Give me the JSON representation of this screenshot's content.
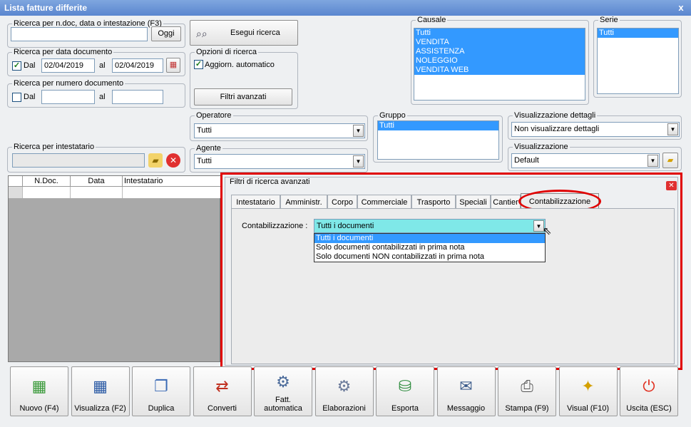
{
  "window": {
    "title": "Lista fatture differite",
    "close": "x"
  },
  "search": {
    "legend": "Ricerca per n.doc, data o intestazione (F3)",
    "value": "",
    "oggi": "Oggi",
    "eseguiRicerca": "Esegui ricerca"
  },
  "dateSearch": {
    "legend": "Ricerca per data documento",
    "dal": "Dal",
    "dal_checked": "✓",
    "from": "02/04/2019",
    "al": "al",
    "to": "02/04/2019"
  },
  "numSearch": {
    "legend": "Ricerca per numero documento",
    "dal": "Dal",
    "al": "al",
    "from": "",
    "to": ""
  },
  "options": {
    "legend": "Opzioni di ricerca",
    "aggiorn": "Aggiorn. automatico",
    "aggiorn_checked": "✓",
    "filtri": "Filtri avanzati"
  },
  "causale": {
    "legend": "Causale",
    "items": [
      "Tutti",
      "VENDITA",
      "ASSISTENZA",
      "NOLEGGIO",
      "VENDITA WEB"
    ]
  },
  "serie": {
    "legend": "Serie",
    "items": [
      "Tutti"
    ]
  },
  "operatore": {
    "legend": "Operatore",
    "value": "Tutti"
  },
  "agente": {
    "legend": "Agente",
    "value": "Tutti"
  },
  "gruppo": {
    "legend": "Gruppo",
    "items": [
      "Tutti"
    ]
  },
  "visDettagli": {
    "legend": "Visualizzazione dettagli",
    "value": "Non visualizzare dettagli"
  },
  "visualizzazione": {
    "legend": "Visualizzazione",
    "value": "Default"
  },
  "intestatario": {
    "legend": "Ricerca per intestatario",
    "value": ""
  },
  "grid": {
    "columns": [
      "N.Doc.",
      "Data",
      "Intestatario"
    ]
  },
  "advanced": {
    "legend": "Filtri di ricerca avanzati",
    "tabs": [
      "Intestatario",
      "Amministr.",
      "Corpo",
      "Commerciale",
      "Trasporto",
      "Speciali",
      "Cantier",
      "Contabilizzazione"
    ],
    "active_tab": "Contabilizzazione",
    "label": "Contabilizzazione :",
    "value": "Tutti i documenti",
    "options": [
      "Tutti i documenti",
      "Solo documenti contabilizzati in prima nota",
      "Solo documenti NON contabilizzati in prima nota"
    ]
  },
  "toolbar": [
    {
      "label": "Nuovo (F4)",
      "icon": "new-doc-icon",
      "glyph": "▦",
      "color": "#3a9a3a"
    },
    {
      "label": "Visualizza (F2)",
      "icon": "view-doc-icon",
      "glyph": "▦",
      "color": "#2a5aa5"
    },
    {
      "label": "Duplica",
      "icon": "duplicate-icon",
      "glyph": "❐",
      "color": "#3a6ab5"
    },
    {
      "label": "Converti",
      "icon": "convert-icon",
      "glyph": "⇄",
      "color": "#c03020"
    },
    {
      "label": "Fatt.\nautomatica",
      "icon": "gear-magnifier-icon",
      "glyph": "⚙",
      "color": "#4a6a9a"
    },
    {
      "label": "Elaborazioni",
      "icon": "processing-icon",
      "glyph": "⚙",
      "color": "#6a7a9a"
    },
    {
      "label": "Esporta",
      "icon": "export-icon",
      "glyph": "⛁",
      "color": "#2a8a3a"
    },
    {
      "label": "Messaggio",
      "icon": "message-icon",
      "glyph": "✉",
      "color": "#3a5a8a"
    },
    {
      "label": "Stampa (F9)",
      "icon": "print-icon",
      "glyph": "⎙",
      "color": "#555555"
    },
    {
      "label": "Visual (F10)",
      "icon": "magic-wand-icon",
      "glyph": "✦",
      "color": "#d4a000"
    },
    {
      "label": "Uscita (ESC)",
      "icon": "exit-icon",
      "glyph": "⏻",
      "color": "#e03020"
    }
  ],
  "colors": {
    "selection": "#3399ff",
    "highlight": "#e00000",
    "combo_selected": "#7fe8e8"
  }
}
